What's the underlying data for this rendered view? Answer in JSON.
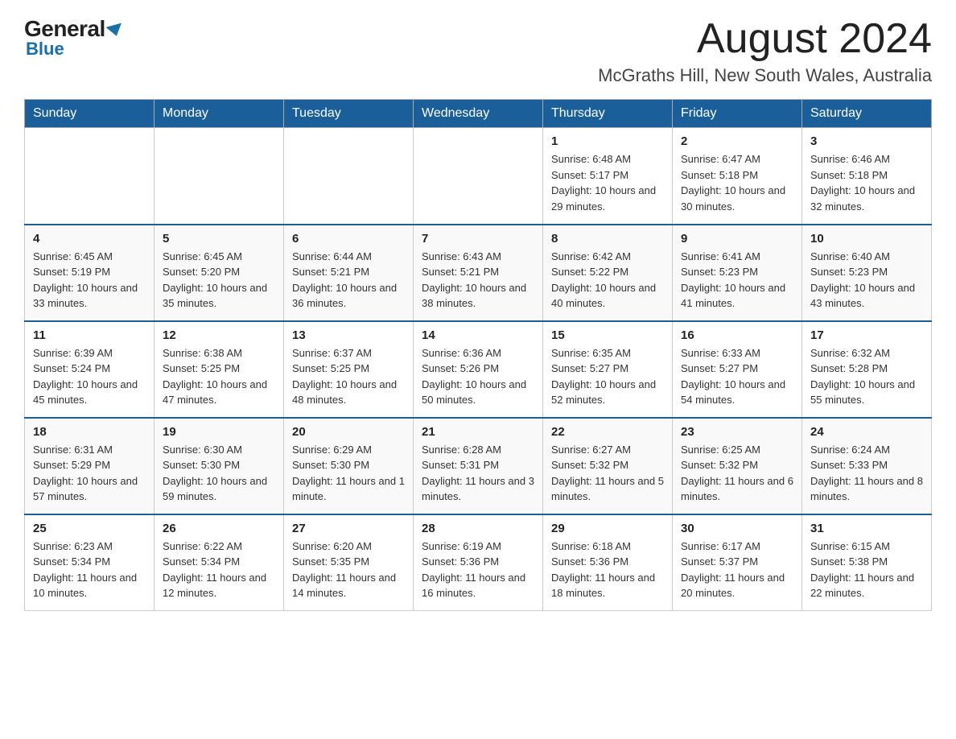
{
  "header": {
    "logo_general": "General",
    "logo_blue": "Blue",
    "month_title": "August 2024",
    "location": "McGraths Hill, New South Wales, Australia"
  },
  "days_of_week": [
    "Sunday",
    "Monday",
    "Tuesday",
    "Wednesday",
    "Thursday",
    "Friday",
    "Saturday"
  ],
  "weeks": [
    {
      "days": [
        {
          "number": "",
          "info": ""
        },
        {
          "number": "",
          "info": ""
        },
        {
          "number": "",
          "info": ""
        },
        {
          "number": "",
          "info": ""
        },
        {
          "number": "1",
          "info": "Sunrise: 6:48 AM\nSunset: 5:17 PM\nDaylight: 10 hours and 29 minutes."
        },
        {
          "number": "2",
          "info": "Sunrise: 6:47 AM\nSunset: 5:18 PM\nDaylight: 10 hours and 30 minutes."
        },
        {
          "number": "3",
          "info": "Sunrise: 6:46 AM\nSunset: 5:18 PM\nDaylight: 10 hours and 32 minutes."
        }
      ]
    },
    {
      "days": [
        {
          "number": "4",
          "info": "Sunrise: 6:45 AM\nSunset: 5:19 PM\nDaylight: 10 hours and 33 minutes."
        },
        {
          "number": "5",
          "info": "Sunrise: 6:45 AM\nSunset: 5:20 PM\nDaylight: 10 hours and 35 minutes."
        },
        {
          "number": "6",
          "info": "Sunrise: 6:44 AM\nSunset: 5:21 PM\nDaylight: 10 hours and 36 minutes."
        },
        {
          "number": "7",
          "info": "Sunrise: 6:43 AM\nSunset: 5:21 PM\nDaylight: 10 hours and 38 minutes."
        },
        {
          "number": "8",
          "info": "Sunrise: 6:42 AM\nSunset: 5:22 PM\nDaylight: 10 hours and 40 minutes."
        },
        {
          "number": "9",
          "info": "Sunrise: 6:41 AM\nSunset: 5:23 PM\nDaylight: 10 hours and 41 minutes."
        },
        {
          "number": "10",
          "info": "Sunrise: 6:40 AM\nSunset: 5:23 PM\nDaylight: 10 hours and 43 minutes."
        }
      ]
    },
    {
      "days": [
        {
          "number": "11",
          "info": "Sunrise: 6:39 AM\nSunset: 5:24 PM\nDaylight: 10 hours and 45 minutes."
        },
        {
          "number": "12",
          "info": "Sunrise: 6:38 AM\nSunset: 5:25 PM\nDaylight: 10 hours and 47 minutes."
        },
        {
          "number": "13",
          "info": "Sunrise: 6:37 AM\nSunset: 5:25 PM\nDaylight: 10 hours and 48 minutes."
        },
        {
          "number": "14",
          "info": "Sunrise: 6:36 AM\nSunset: 5:26 PM\nDaylight: 10 hours and 50 minutes."
        },
        {
          "number": "15",
          "info": "Sunrise: 6:35 AM\nSunset: 5:27 PM\nDaylight: 10 hours and 52 minutes."
        },
        {
          "number": "16",
          "info": "Sunrise: 6:33 AM\nSunset: 5:27 PM\nDaylight: 10 hours and 54 minutes."
        },
        {
          "number": "17",
          "info": "Sunrise: 6:32 AM\nSunset: 5:28 PM\nDaylight: 10 hours and 55 minutes."
        }
      ]
    },
    {
      "days": [
        {
          "number": "18",
          "info": "Sunrise: 6:31 AM\nSunset: 5:29 PM\nDaylight: 10 hours and 57 minutes."
        },
        {
          "number": "19",
          "info": "Sunrise: 6:30 AM\nSunset: 5:30 PM\nDaylight: 10 hours and 59 minutes."
        },
        {
          "number": "20",
          "info": "Sunrise: 6:29 AM\nSunset: 5:30 PM\nDaylight: 11 hours and 1 minute."
        },
        {
          "number": "21",
          "info": "Sunrise: 6:28 AM\nSunset: 5:31 PM\nDaylight: 11 hours and 3 minutes."
        },
        {
          "number": "22",
          "info": "Sunrise: 6:27 AM\nSunset: 5:32 PM\nDaylight: 11 hours and 5 minutes."
        },
        {
          "number": "23",
          "info": "Sunrise: 6:25 AM\nSunset: 5:32 PM\nDaylight: 11 hours and 6 minutes."
        },
        {
          "number": "24",
          "info": "Sunrise: 6:24 AM\nSunset: 5:33 PM\nDaylight: 11 hours and 8 minutes."
        }
      ]
    },
    {
      "days": [
        {
          "number": "25",
          "info": "Sunrise: 6:23 AM\nSunset: 5:34 PM\nDaylight: 11 hours and 10 minutes."
        },
        {
          "number": "26",
          "info": "Sunrise: 6:22 AM\nSunset: 5:34 PM\nDaylight: 11 hours and 12 minutes."
        },
        {
          "number": "27",
          "info": "Sunrise: 6:20 AM\nSunset: 5:35 PM\nDaylight: 11 hours and 14 minutes."
        },
        {
          "number": "28",
          "info": "Sunrise: 6:19 AM\nSunset: 5:36 PM\nDaylight: 11 hours and 16 minutes."
        },
        {
          "number": "29",
          "info": "Sunrise: 6:18 AM\nSunset: 5:36 PM\nDaylight: 11 hours and 18 minutes."
        },
        {
          "number": "30",
          "info": "Sunrise: 6:17 AM\nSunset: 5:37 PM\nDaylight: 11 hours and 20 minutes."
        },
        {
          "number": "31",
          "info": "Sunrise: 6:15 AM\nSunset: 5:38 PM\nDaylight: 11 hours and 22 minutes."
        }
      ]
    }
  ]
}
